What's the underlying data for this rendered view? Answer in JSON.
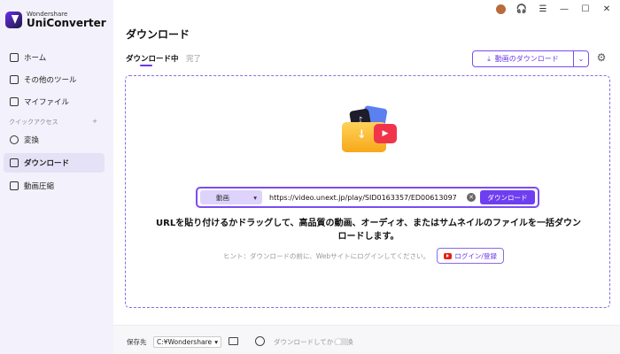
{
  "brand": {
    "company": "Wondershare",
    "product": "UniConverter"
  },
  "sidebar": {
    "items": [
      {
        "label": "ホーム",
        "icon": "home-icon"
      },
      {
        "label": "その他のツール",
        "icon": "tools-icon"
      },
      {
        "label": "マイファイル",
        "icon": "file-icon"
      }
    ],
    "quick_access_label": "クイックアクセス",
    "quick_items": [
      {
        "label": "変換",
        "icon": "convert-icon"
      },
      {
        "label": "ダウンロード",
        "icon": "download-icon",
        "active": true
      },
      {
        "label": "動画圧縮",
        "icon": "compress-icon"
      }
    ]
  },
  "header": {
    "title": "ダウンロード"
  },
  "tabs": [
    {
      "label": "ダウンロード中",
      "active": true
    },
    {
      "label": "完了",
      "active": false
    }
  ],
  "toolbar": {
    "download_button_label": "動画のダウンロード"
  },
  "dropzone": {
    "media_type": "動画",
    "url_value": "https://video.unext.jp/play/SID0163357/ED00613097",
    "download_button_label": "ダウンロード",
    "message": "URLを貼り付けるかドラッグして、高品質の動画、オーディオ、またはサムネイルのファイルを一括ダウンロードします。",
    "hint": "ヒント：ダウンロードの前に、Webサイトにログインしてください。",
    "login_button_label": "ログイン/登録"
  },
  "footer": {
    "save_to_label": "保存先",
    "save_path": "C:¥Wondershare",
    "convert_after_label": "ダウンロードしてから変換"
  },
  "colors": {
    "accent": "#6f3ef0",
    "sidebar_bg": "#f3f1fb"
  }
}
